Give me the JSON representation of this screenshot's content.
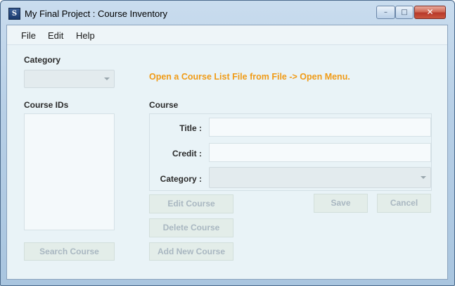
{
  "window": {
    "title": "My Final Project : Course Inventory",
    "app_icon_letter": "S",
    "controls": {
      "minimize": "–",
      "maximize": "□",
      "close": "✕"
    }
  },
  "menu": {
    "items": [
      "File",
      "Edit",
      "Help"
    ]
  },
  "left_panel": {
    "category_label": "Category",
    "category_value": "",
    "course_ids_label": "Course IDs",
    "course_ids": [],
    "search_button": "Search Course"
  },
  "hint": "Open a Course List File from File -> Open Menu.",
  "course": {
    "group_label": "Course",
    "title_label": "Title :",
    "title_value": "",
    "credit_label": "Credit :",
    "credit_value": "",
    "category_label": "Category :",
    "category_value": ""
  },
  "buttons": {
    "edit": "Edit Course",
    "delete": "Delete Course",
    "add": "Add New Course",
    "save": "Save",
    "cancel": "Cancel"
  },
  "colors": {
    "hint": "#f09b17",
    "disabled_text": "#a9b7c1",
    "client_bg": "#e9f3f7"
  },
  "icons": {
    "dropdown": "chevron-down-icon",
    "app": "app-icon"
  }
}
